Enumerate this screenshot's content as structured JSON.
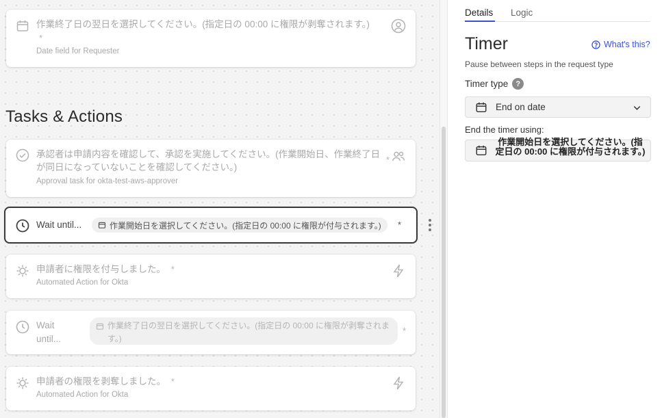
{
  "canvas": {
    "requester_card": {
      "title": "作業終了日の翌日を選択してください。(指定日の 00:00 に権限が剥奪されます。)",
      "asterisk": "*",
      "subtitle": "Date field for Requester"
    },
    "section_title": "Tasks & Actions",
    "approval_card": {
      "title": "承認者は申請内容を確認して、承認を実施してください。(作業開始日、作業終了日が同日になっていないことを確認してください。)",
      "asterisk": "*",
      "subtitle": "Approval task for okta-test-aws-approver"
    },
    "timer_card_1": {
      "label": "Wait until...",
      "pill": "作業開始日を選択してください。(指定日の 00:00 に権限が付与されます。)",
      "asterisk": "*"
    },
    "action_card_1": {
      "title": "申請者に権限を付与しました。",
      "asterisk": "*",
      "subtitle": "Automated Action for Okta"
    },
    "timer_card_2": {
      "label": "Wait until...",
      "pill": "作業終了日の翌日を選択してください。(指定日の 00:00 に権限が剥奪されます。)",
      "asterisk": "*"
    },
    "action_card_2": {
      "title": "申請者の権限を剥奪しました。",
      "asterisk": "*",
      "subtitle": "Automated Action for Okta"
    }
  },
  "panel": {
    "tabs": [
      {
        "label": "Details",
        "active": true
      },
      {
        "label": "Logic",
        "active": false
      }
    ],
    "title": "Timer",
    "help_link": "What's this?",
    "description": "Pause between steps in the request type",
    "timer_type_label": "Timer type",
    "timer_type_value": "End on date",
    "end_label": "End the timer using:",
    "end_value": "作業開始日を選択してください。(指定日の 00:00 に権限が付与されます。)"
  },
  "colors": {
    "accent": "#3b4fd8",
    "muted_text": "#a9a9a9"
  },
  "icons": {
    "calendar": "calendar-icon",
    "clock": "clock-icon",
    "check": "check-circle-icon",
    "gear": "gear-icon",
    "bolt": "bolt-icon",
    "users": "users-icon",
    "user": "user-circle-icon",
    "chevron": "chevron-down-icon",
    "help": "help-circle-icon"
  }
}
